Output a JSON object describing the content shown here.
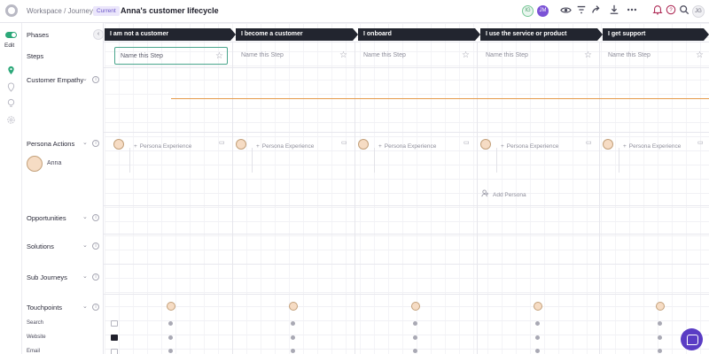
{
  "header": {
    "breadcrumb": "Workspace / Journeys /",
    "badge": "Current",
    "title": "Anna's customer lifecycle",
    "collaborators": [
      "IG",
      "JM"
    ],
    "user_initials": "JG",
    "icons": [
      "eye-icon",
      "filter-icon",
      "share-icon",
      "download-icon",
      "more-icon",
      "bell-icon",
      "help-icon",
      "search-icon"
    ]
  },
  "rail": {
    "edit_label": "Edit",
    "icons": [
      "pin-icon",
      "location-icon",
      "bulb-icon",
      "settings-icon"
    ]
  },
  "rows": {
    "phases": "Phases",
    "steps": "Steps",
    "customer_empathy": "Customer Empathy",
    "persona_actions": "Persona Actions",
    "persona_name": "Anna",
    "opportunities": "Opportunities",
    "solutions": "Solutions",
    "sub_journeys": "Sub Journeys",
    "touchpoints": "Touchpoints",
    "touchpoint_items": [
      "Search",
      "Website",
      "Email"
    ]
  },
  "phases": [
    "I am not a customer",
    "I become a customer",
    "I onboard",
    "I use the service or product",
    "I get support"
  ],
  "steps": [
    "Name this Step",
    "Name this Step",
    "Name this Step",
    "Name this Step",
    "Name this Step"
  ],
  "persona_experience": "Persona Experience",
  "add_persona": "Add Persona",
  "colors": {
    "accent_green": "#2ca879",
    "empathy_line": "#e59a4a",
    "phase_bg": "#22252f",
    "chat_purple": "#5a3cc4"
  }
}
